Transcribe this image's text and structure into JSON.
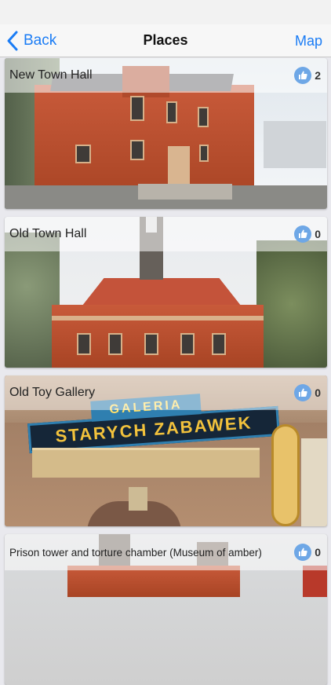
{
  "nav": {
    "back_label": "Back",
    "title": "Places",
    "map_label": "Map"
  },
  "places": [
    {
      "name": "New Town Hall",
      "likes": "2"
    },
    {
      "name": "Old Town Hall",
      "likes": "0"
    },
    {
      "name": "Old Toy Gallery",
      "likes": "0",
      "sign_top": "GALERIA",
      "sign_main": "STARYCH ZABAWEK"
    },
    {
      "name": "Prison tower and torture chamber (Museum of amber)",
      "likes": "0"
    }
  ],
  "colors": {
    "accent": "#1a7cf5",
    "like_badge": "#6ea7e6"
  },
  "icons": {
    "back": "chevron-left-icon",
    "like": "thumbs-up-icon"
  }
}
